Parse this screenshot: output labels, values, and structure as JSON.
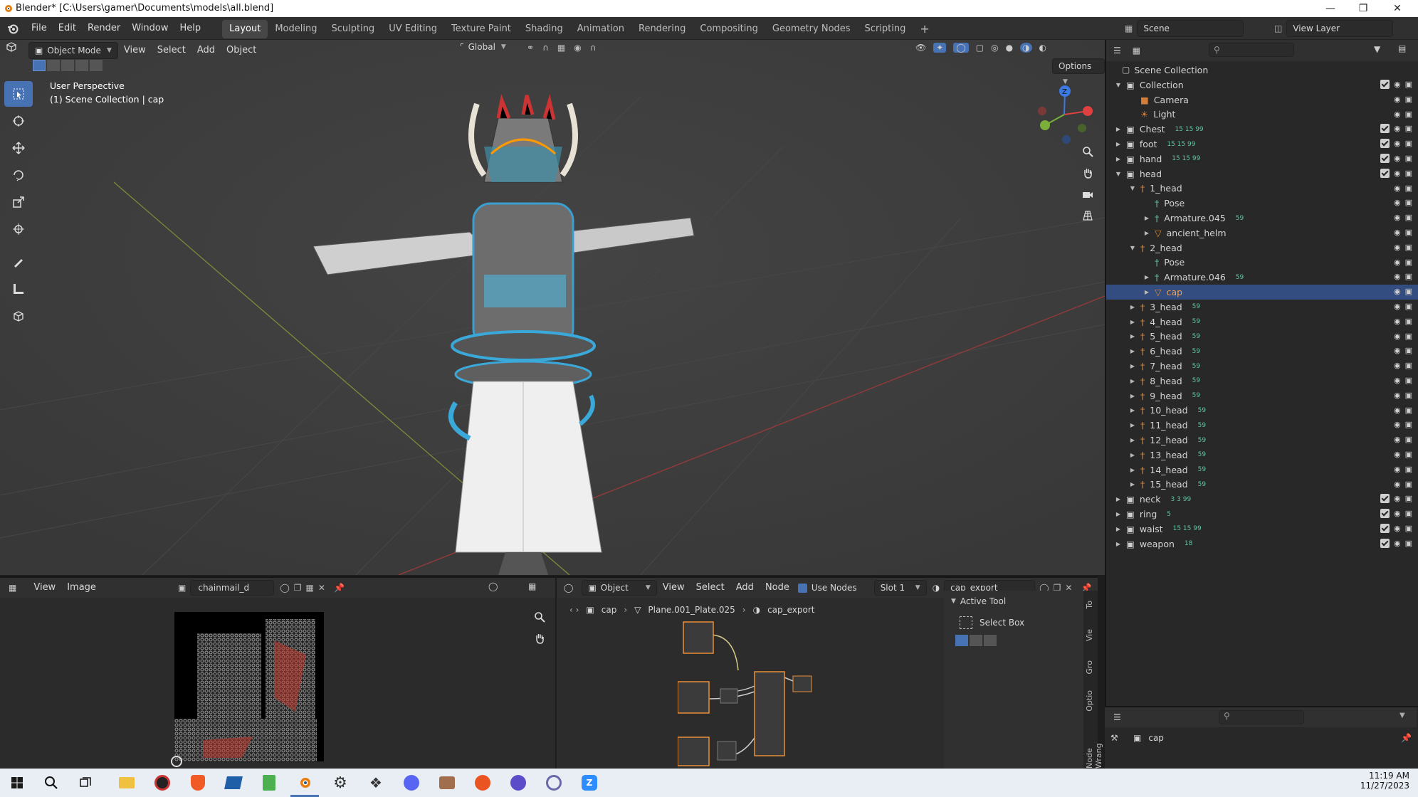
{
  "window": {
    "title": "Blender* [C:\\Users\\gamer\\Documents\\models\\all.blend]"
  },
  "menu": [
    "File",
    "Edit",
    "Render",
    "Window",
    "Help"
  ],
  "workspaces": {
    "active": "Layout",
    "tabs": [
      "Layout",
      "Modeling",
      "Sculpting",
      "UV Editing",
      "Texture Paint",
      "Shading",
      "Animation",
      "Rendering",
      "Compositing",
      "Geometry Nodes",
      "Scripting"
    ]
  },
  "scene": {
    "label": "Scene",
    "view_layer": "View Layer"
  },
  "viewport": {
    "mode": "Object Mode",
    "menus": [
      "View",
      "Select",
      "Add",
      "Object"
    ],
    "transform_orientation": "Global",
    "options_label": "Options",
    "overlay_title": "User Perspective",
    "overlay_subtitle": "(1) Scene Collection | cap"
  },
  "outliner": {
    "root": "Scene Collection",
    "rows": [
      {
        "label": "Collection",
        "depth": 0,
        "kind": "collection",
        "expanded": true,
        "check": true
      },
      {
        "label": "Camera",
        "depth": 1,
        "kind": "camera"
      },
      {
        "label": "Light",
        "depth": 1,
        "kind": "light"
      },
      {
        "label": "Chest",
        "depth": 0,
        "kind": "collection",
        "check": true,
        "badges": "15 15 99"
      },
      {
        "label": "foot",
        "depth": 0,
        "kind": "collection",
        "check": true,
        "badges": "15 15 99"
      },
      {
        "label": "hand",
        "depth": 0,
        "kind": "collection",
        "check": true,
        "badges": "15 15 99"
      },
      {
        "label": "head",
        "depth": 0,
        "kind": "collection",
        "expanded": true,
        "check": true
      },
      {
        "label": "1_head",
        "depth": 1,
        "kind": "armature",
        "expanded": true
      },
      {
        "label": "Pose",
        "depth": 2,
        "kind": "pose"
      },
      {
        "label": "Armature.045",
        "depth": 2,
        "kind": "armature-data",
        "badges": "59"
      },
      {
        "label": "ancient_helm",
        "depth": 2,
        "kind": "mesh"
      },
      {
        "label": "2_head",
        "depth": 1,
        "kind": "armature",
        "expanded": true
      },
      {
        "label": "Pose",
        "depth": 2,
        "kind": "pose"
      },
      {
        "label": "Armature.046",
        "depth": 2,
        "kind": "armature-data",
        "badges": "59"
      },
      {
        "label": "cap",
        "depth": 2,
        "kind": "mesh",
        "selected": true
      },
      {
        "label": "3_head",
        "depth": 1,
        "kind": "armature",
        "badges": "59"
      },
      {
        "label": "4_head",
        "depth": 1,
        "kind": "armature",
        "badges": "59"
      },
      {
        "label": "5_head",
        "depth": 1,
        "kind": "armature",
        "badges": "59"
      },
      {
        "label": "6_head",
        "depth": 1,
        "kind": "armature",
        "badges": "59"
      },
      {
        "label": "7_head",
        "depth": 1,
        "kind": "armature",
        "badges": "59"
      },
      {
        "label": "8_head",
        "depth": 1,
        "kind": "armature",
        "badges": "59"
      },
      {
        "label": "9_head",
        "depth": 1,
        "kind": "armature",
        "badges": "59"
      },
      {
        "label": "10_head",
        "depth": 1,
        "kind": "armature",
        "badges": "59"
      },
      {
        "label": "11_head",
        "depth": 1,
        "kind": "armature",
        "badges": "59"
      },
      {
        "label": "12_head",
        "depth": 1,
        "kind": "armature",
        "badges": "59"
      },
      {
        "label": "13_head",
        "depth": 1,
        "kind": "armature",
        "badges": "59"
      },
      {
        "label": "14_head",
        "depth": 1,
        "kind": "armature",
        "badges": "59"
      },
      {
        "label": "15_head",
        "depth": 1,
        "kind": "armature",
        "badges": "59"
      },
      {
        "label": "neck",
        "depth": 0,
        "kind": "collection",
        "check": true,
        "badges": "3 3 99"
      },
      {
        "label": "ring",
        "depth": 0,
        "kind": "collection",
        "check": true,
        "badges": "5"
      },
      {
        "label": "waist",
        "depth": 0,
        "kind": "collection",
        "check": true,
        "badges": "15 15 99"
      },
      {
        "label": "weapon",
        "depth": 0,
        "kind": "collection",
        "check": true,
        "badges": "18"
      }
    ]
  },
  "image_editor": {
    "menus": [
      "View",
      "Image"
    ],
    "image_name": "chainmail_d"
  },
  "node_editor": {
    "object_dropdown": "Object",
    "menus": [
      "View",
      "Select",
      "Add",
      "Node"
    ],
    "use_nodes_label": "Use Nodes",
    "slot": "Slot 1",
    "material": "cap_export",
    "breadcrumb": [
      "cap",
      "Plane.001_Plate.025",
      "cap_export"
    ]
  },
  "side_panel": {
    "section": "Active Tool",
    "tool": "Select Box",
    "tabs": [
      "To",
      "Vie",
      "Gro",
      "Optio",
      "Node Wrang"
    ]
  },
  "properties": {
    "object_name": "cap"
  },
  "taskbar": {
    "time": "11:19 AM",
    "date": "11/27/2023"
  },
  "colors": {
    "accent": "#4772b3",
    "selection": "#334d80",
    "outliner_teal": "#5fc6a3",
    "armature_orange": "#e0882e"
  }
}
